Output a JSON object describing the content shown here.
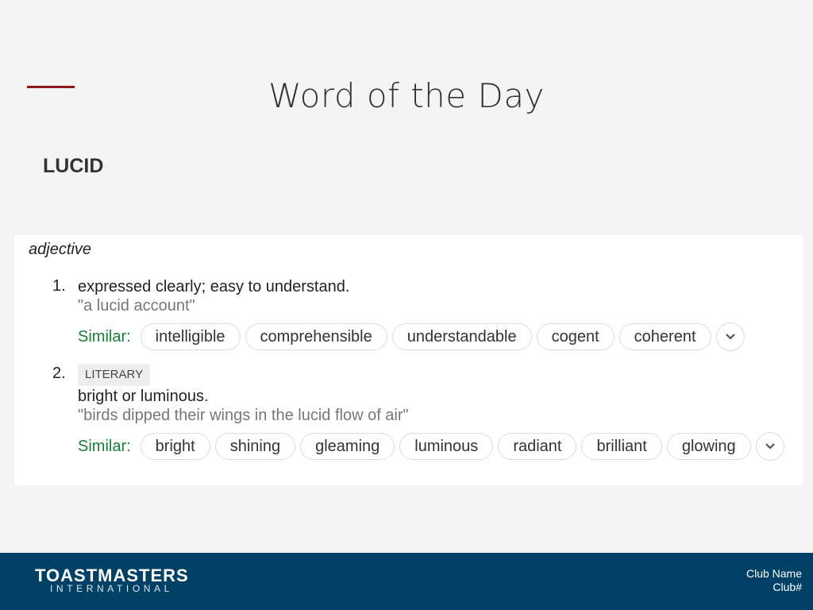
{
  "slide": {
    "title": "Word of the Day",
    "word": "LUCID"
  },
  "definition_card": {
    "part_of_speech": "adjective",
    "similar_label": "Similar:",
    "senses": [
      {
        "number": "1.",
        "register": null,
        "definition": "expressed clearly; easy to understand.",
        "example": "\"a lucid account\"",
        "similar": [
          "intelligible",
          "comprehensible",
          "understandable",
          "cogent",
          "coherent"
        ],
        "more_icon": "chevron-down-icon"
      },
      {
        "number": "2.",
        "register": "LITERARY",
        "definition": "bright or luminous.",
        "example": "\"birds dipped their wings in the lucid flow of air\"",
        "similar": [
          "bright",
          "shining",
          "gleaming",
          "luminous",
          "radiant",
          "brilliant",
          "glowing"
        ],
        "more_icon": "chevron-down-icon"
      }
    ]
  },
  "footer": {
    "logo_main": "TOASTMASTERS",
    "logo_sub": "INTERNATIONAL",
    "club_name": "Club Name",
    "club_number": "Club#"
  },
  "colors": {
    "accent": "#8b1a1a",
    "footer_bg": "#004165",
    "similar_label": "#188038"
  }
}
